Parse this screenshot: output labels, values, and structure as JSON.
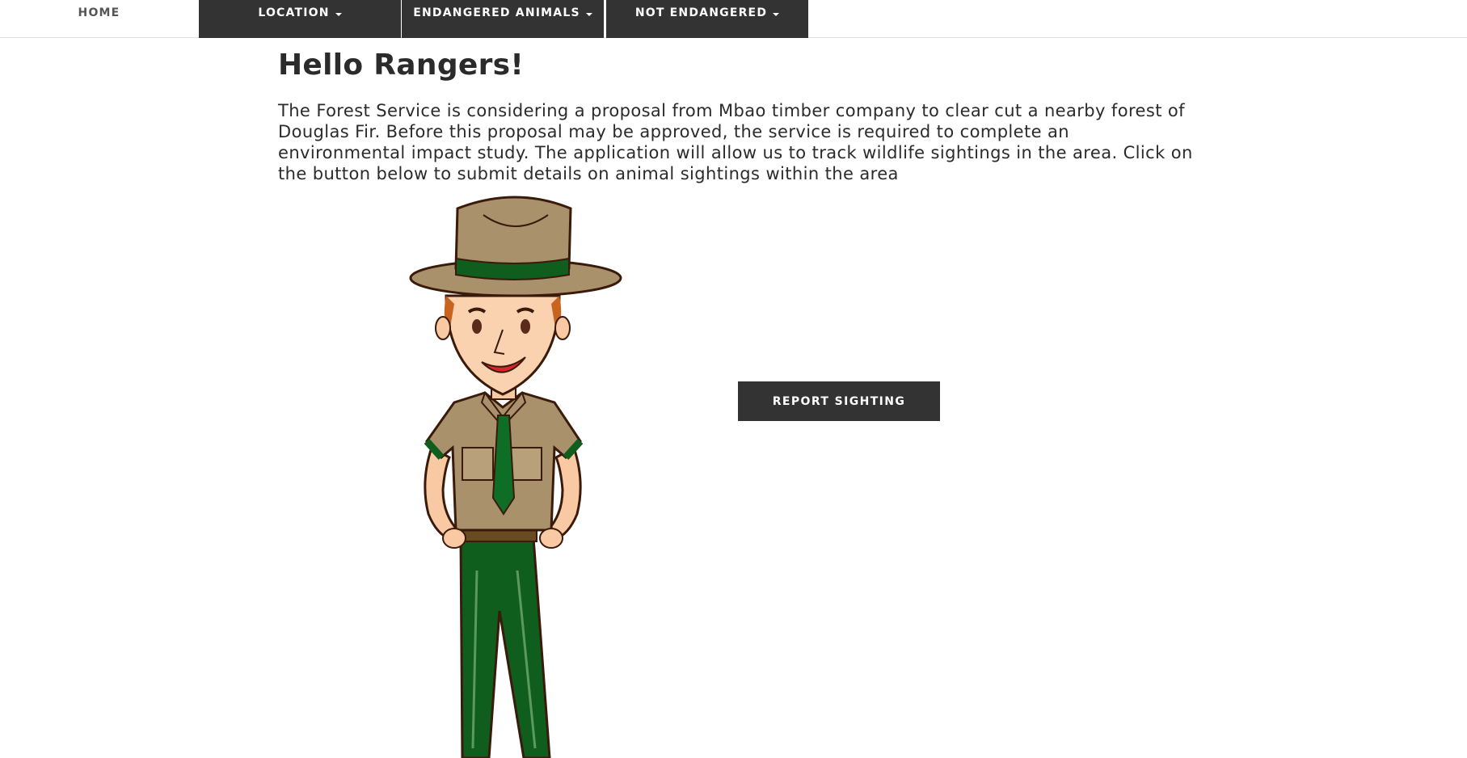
{
  "nav": {
    "home": "HOME",
    "location": "LOCATION",
    "endangered": "ENDANGERED ANIMALS",
    "not_endangered": "NOT ENDANGERED"
  },
  "main": {
    "title": "Hello Rangers!",
    "intro": "The Forest Service is considering a proposal from Mbao timber company to clear cut a nearby forest of Douglas Fir. Before this proposal may be approved, the service is required to complete an environmental impact study. The application will allow us to track wildlife sightings in the area. Click on the button below to submit details on animal sightings within the area",
    "report_button": "REPORT SIGHTING"
  },
  "illustration": {
    "icon": "park-ranger-illustration"
  },
  "colors": {
    "nav_dark": "#333333",
    "button": "#333333",
    "ranger_uniform": "#a8916b",
    "ranger_pants": "#0f5e1e"
  }
}
